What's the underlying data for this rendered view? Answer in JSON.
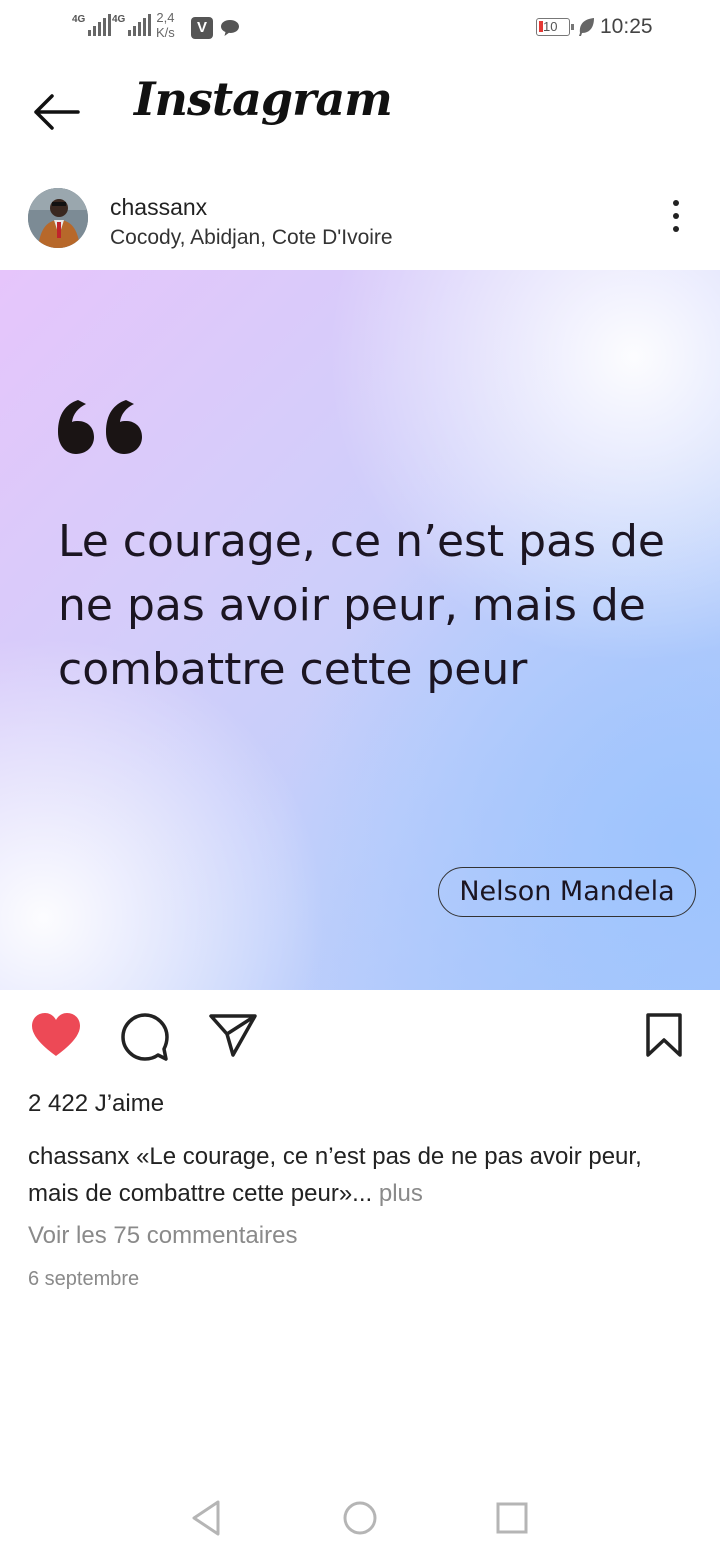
{
  "status_bar": {
    "net1": "4G",
    "net2": "4G",
    "speed_value": "2,4",
    "speed_unit": "K/s",
    "battery": "10",
    "time": "10:25"
  },
  "header": {
    "app_name": "Instagram"
  },
  "post": {
    "username": "chassanx",
    "location": "Cocody, Abidjan, Cote D'Ivoire",
    "image": {
      "quote": "Le courage, ce n’est pas de ne pas avoir peur, mais de combattre cette peur",
      "author": "Nelson Mandela"
    },
    "likes": "2 422 J’aime",
    "caption_user": "chassanx",
    "caption_text": "«Le courage, ce n’est pas de ne pas avoir peur, mais de combattre cette peur»...",
    "caption_more": "plus",
    "comments_link": "Voir les 75 commentaires",
    "date": "6 septembre",
    "liked": true
  },
  "colors": {
    "like_red": "#ed4956",
    "text": "#222222",
    "muted": "#8a8a8a"
  }
}
